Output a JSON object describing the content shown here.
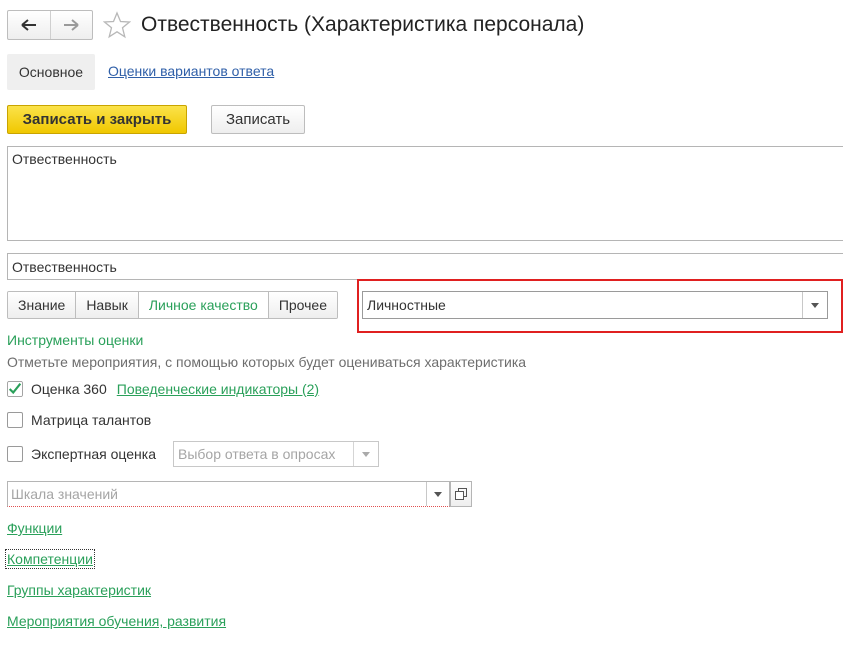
{
  "header": {
    "title": "Отвественность (Характеристика персонала)"
  },
  "tabs": {
    "main": "Основное",
    "answer_ratings": "Оценки вариантов ответа"
  },
  "toolbar": {
    "save_close_label": "Записать и закрыть",
    "save_label": "Записать"
  },
  "form": {
    "description": "Отвественность",
    "name": "Отвественность",
    "type_options": [
      "Знание",
      "Навык",
      "Личное качество",
      "Прочее"
    ],
    "selected_type": "Личное качество",
    "kind_value": "Личностные"
  },
  "assessment": {
    "section_title": "Инструменты оценки",
    "note": "Отметьте мероприятия, с помощью которых будет оцениваться характеристика",
    "eval360": {
      "label": "Оценка 360",
      "checked": true,
      "link": "Поведенческие индикаторы (2)"
    },
    "talent_matrix": {
      "label": "Матрица талантов",
      "checked": false
    },
    "expert": {
      "label": "Экспертная оценка",
      "checked": false,
      "select_placeholder": "Выбор ответа в опросах"
    },
    "scale_placeholder": "Шкала значений"
  },
  "links": [
    "Функции",
    "Компетенции",
    "Группы характеристик",
    "Мероприятия обучения, развития"
  ],
  "colors": {
    "accent_green": "#2aa05a",
    "primary_button": "#f5d21c",
    "highlight_frame": "#e02020",
    "link_blue": "#2f5fa8"
  },
  "icons": {
    "back": "arrow-left-icon",
    "forward": "arrow-right-icon",
    "favorite": "star-outline-icon",
    "dropdown": "caret-down-icon",
    "open": "open-form-icon",
    "check": "checkmark-icon"
  }
}
